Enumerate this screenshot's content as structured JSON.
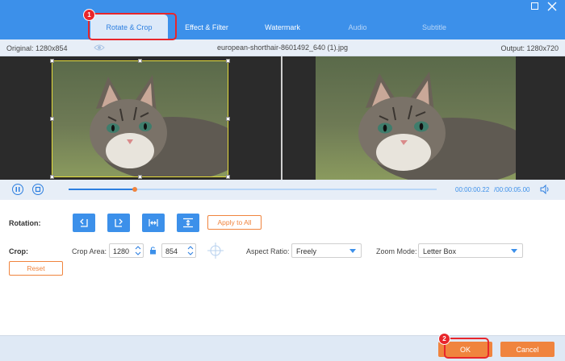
{
  "tabs": [
    {
      "label": "Rotate & Crop"
    },
    {
      "label": "Effect & Filter"
    },
    {
      "label": "Watermark"
    },
    {
      "label": "Audio"
    },
    {
      "label": "Subtitle"
    }
  ],
  "info": {
    "original": "Original: 1280x854",
    "filename": "european-shorthair-8601492_640 (1).jpg",
    "output": "Output: 1280x720"
  },
  "playback": {
    "current_time": "00:00:00.22",
    "total_time": "/00:00:05.00",
    "progress_fraction": 0.18
  },
  "rotation": {
    "label": "Rotation:",
    "buttons": [
      "rotate-left",
      "rotate-right",
      "flip-horizontal",
      "flip-vertical"
    ],
    "apply_label": "Apply to All"
  },
  "crop": {
    "label": "Crop:",
    "area_label": "Crop Area:",
    "width": "1280",
    "height": "854",
    "aspect_label": "Aspect Ratio:",
    "aspect_value": "Freely",
    "zoom_label": "Zoom Mode:",
    "zoom_value": "Letter Box",
    "reset_label": "Reset"
  },
  "footer": {
    "ok_label": "OK",
    "cancel_label": "Cancel"
  },
  "annotations": [
    "1",
    "2"
  ],
  "colors": {
    "accent": "#3c90ea",
    "action": "#f0843e",
    "annotation": "#e8262b"
  }
}
